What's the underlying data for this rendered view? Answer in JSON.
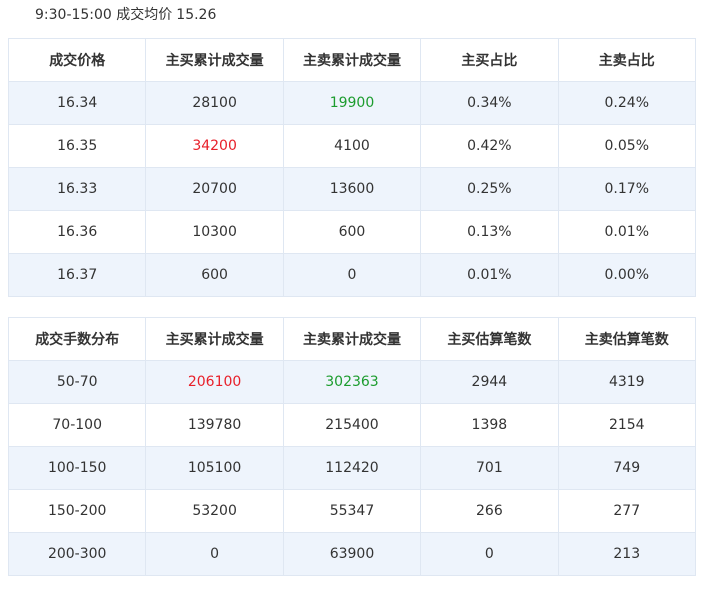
{
  "header": {
    "time_range": "9:30-15:00 成交均价",
    "avg_price": "15.26"
  },
  "price_table": {
    "headers": [
      "成交价格",
      "主买累计成交量",
      "主卖累计成交量",
      "主买占比",
      "主卖占比"
    ],
    "rows": [
      [
        "16.34",
        "28100",
        "19900",
        "0.34%",
        "0.24%"
      ],
      [
        "16.35",
        "34200",
        "4100",
        "0.42%",
        "0.05%"
      ],
      [
        "16.33",
        "20700",
        "13600",
        "0.25%",
        "0.17%"
      ],
      [
        "16.36",
        "10300",
        "600",
        "0.13%",
        "0.01%"
      ],
      [
        "16.37",
        "600",
        "0",
        "0.01%",
        "0.00%"
      ]
    ]
  },
  "size_table": {
    "headers": [
      "成交手数分布",
      "主买累计成交量",
      "主卖累计成交量",
      "主买估算笔数",
      "主卖估算笔数"
    ],
    "rows": [
      [
        "50-70",
        "206100",
        "302363",
        "2944",
        "4319"
      ],
      [
        "70-100",
        "139780",
        "215400",
        "1398",
        "2154"
      ],
      [
        "100-150",
        "105100",
        "112420",
        "701",
        "749"
      ],
      [
        "150-200",
        "53200",
        "55347",
        "266",
        "277"
      ],
      [
        "200-300",
        "0",
        "63900",
        "0",
        "213"
      ]
    ]
  },
  "colors": {
    "highlight_red": "#e8202a",
    "highlight_green": "#1c9c2e",
    "row_stripe": "#eef4fc",
    "border": "#dfe7f2"
  }
}
